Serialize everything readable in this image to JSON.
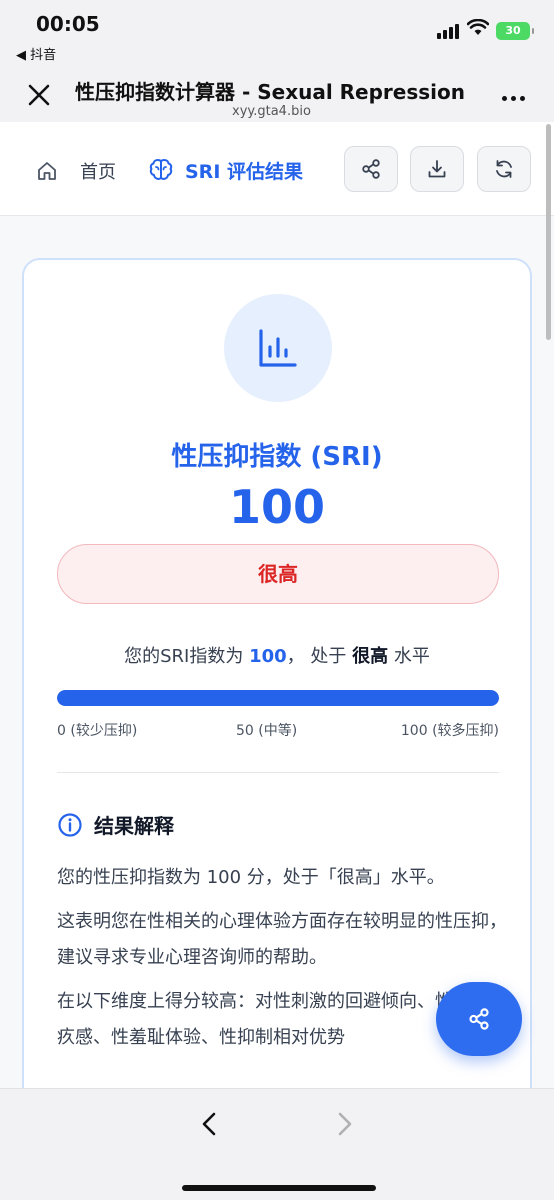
{
  "status_bar": {
    "time": "00:05",
    "back_app": "◀ 抖音",
    "battery": "30"
  },
  "browser": {
    "title": "性压抑指数计算器 - Sexual Repression",
    "url": "xyy.gta4.bio"
  },
  "nav": {
    "home_label": "首页",
    "result_label": "SRI 评估结果"
  },
  "result": {
    "title": "性压抑指数 (SRI)",
    "score": "100",
    "level": "很高",
    "score_fraction": 1.0,
    "summary_prefix": "您的SRI指数为",
    "summary_score": "100",
    "summary_mid": "， 处于",
    "summary_level": "很高",
    "summary_suffix": "水平",
    "scale_min": "0 (较少压抑)",
    "scale_mid": "50 (中等)",
    "scale_max": "100 (较多压抑)"
  },
  "interpretation": {
    "title": "结果解释",
    "p1": "您的性压抑指数为 100 分，处于「很高」水平。",
    "p2": "这表明您在性相关的心理体验方面存在较明显的性压抑，建议寻求专业心理咨询师的帮助。",
    "p3": "在以下维度上得分较高：对性刺激的回避倾向、性相关内疚感、性羞耻体验、性抑制相对优势"
  },
  "colors": {
    "accent": "#2563eb",
    "danger": "#dc2626",
    "badge_bg": "#fdeff0"
  },
  "icons": [
    "home-icon",
    "brain-icon",
    "share-icon",
    "download-icon",
    "refresh-icon",
    "bar-chart-icon",
    "info-icon",
    "close-icon",
    "more-icon",
    "chevron-left-icon",
    "chevron-right-icon"
  ]
}
